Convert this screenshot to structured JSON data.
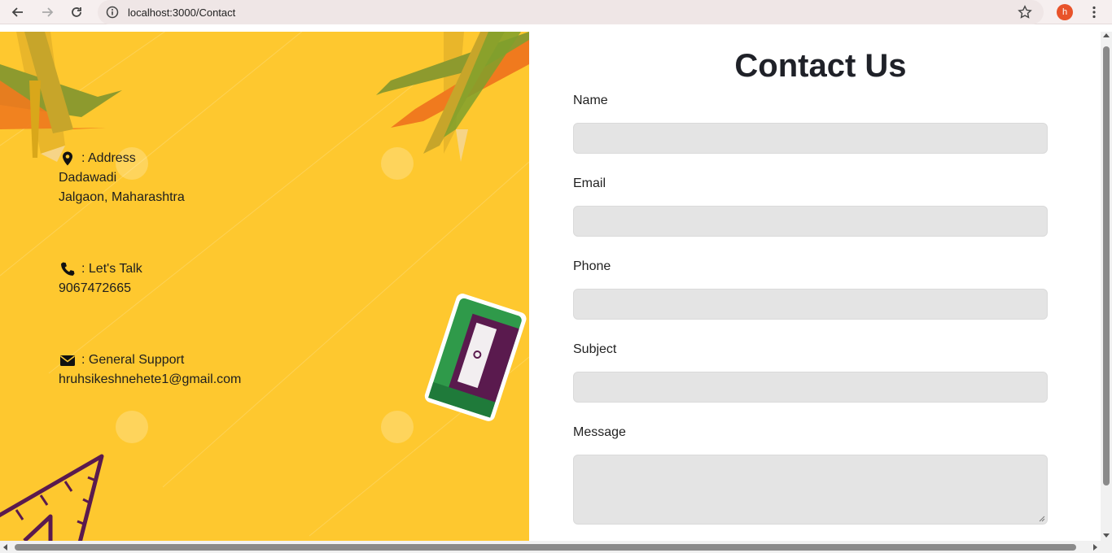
{
  "browser": {
    "url": "localhost:3000/Contact",
    "profile_initial": "h",
    "back_icon": "arrow-left-icon",
    "forward_icon": "arrow-right-icon",
    "reload_icon": "reload-icon",
    "site_info_icon": "info-icon",
    "bookmark_icon": "star-icon",
    "menu_icon": "kebab-menu-icon"
  },
  "contact_info": {
    "address": {
      "icon": "map-pin-icon",
      "heading": ": Address",
      "line1": "Dadawadi",
      "line2": "Jalgaon, Maharashtra"
    },
    "phone": {
      "icon": "phone-icon",
      "heading": ": Let's Talk",
      "value": "9067472665"
    },
    "email": {
      "icon": "envelope-icon",
      "heading": ": General Support",
      "value": "hruhsikeshnehete1@gmail.com"
    }
  },
  "form": {
    "title": "Contact Us",
    "fields": {
      "name": {
        "label": "Name",
        "value": ""
      },
      "email": {
        "label": "Email",
        "value": ""
      },
      "phone": {
        "label": "Phone",
        "value": ""
      },
      "subject": {
        "label": "Subject",
        "value": ""
      },
      "message": {
        "label": "Message",
        "value": ""
      }
    }
  },
  "colors": {
    "panel_background": "#fec82f",
    "input_background": "#e4e4e4",
    "title_color": "#1f2128"
  }
}
